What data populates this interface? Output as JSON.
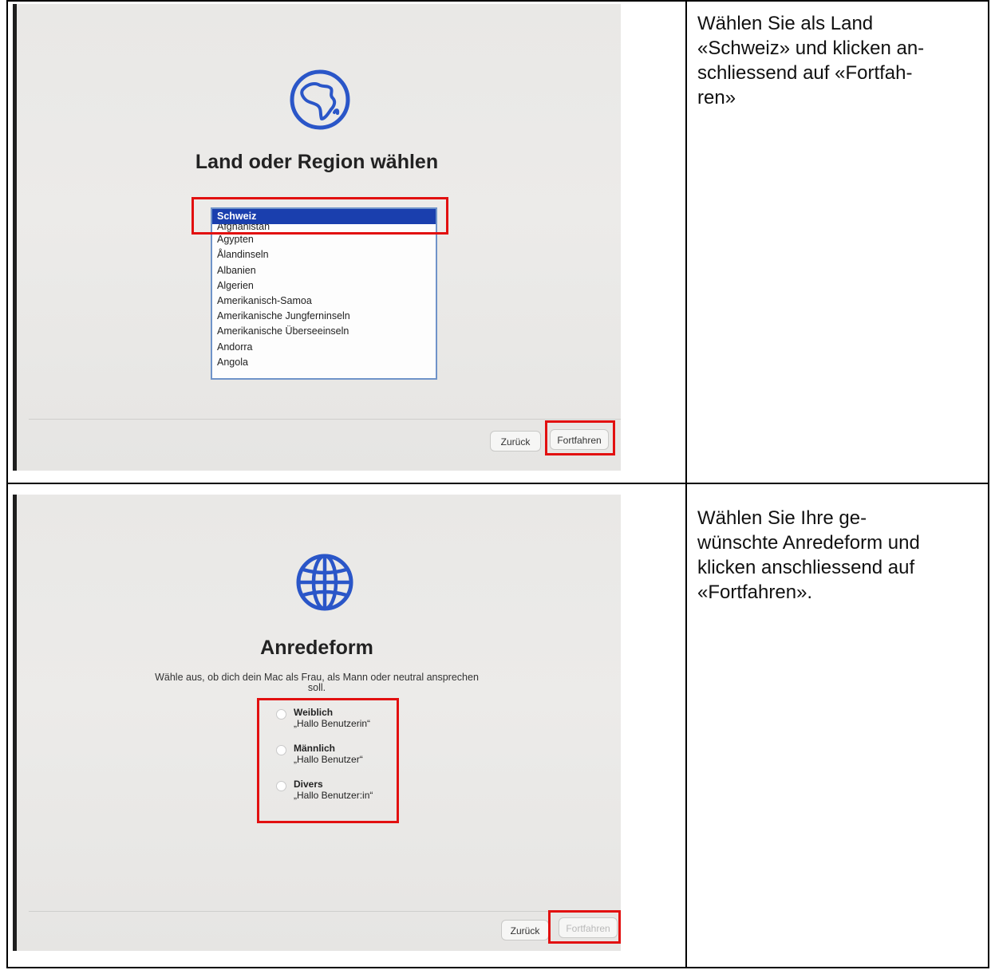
{
  "steps": [
    {
      "instruction": [
        "Wählen Sie als Land",
        "«Schweiz» und klicken an-",
        "schliessend auf «Fortfah-",
        "ren»"
      ],
      "screen": {
        "icon": "globe-africa-icon",
        "title": "Land oder Region wählen",
        "countries": [
          "Schweiz",
          "Afghanistan",
          "Ägypten",
          "Ålandinseln",
          "Albanien",
          "Algerien",
          "Amerikanisch-Samoa",
          "Amerikanische Jungferninseln",
          "Amerikanische Überseeinseln",
          "Andorra",
          "Angola"
        ],
        "selected_country": "Schweiz",
        "back_label": "Zurück",
        "continue_label": "Fortfahren"
      }
    },
    {
      "instruction": [
        "Wählen Sie Ihre ge-",
        "wünschte Anredeform und",
        "klicken anschliessend auf",
        "«Fortfahren»."
      ],
      "screen": {
        "icon": "globe-grid-icon",
        "title": "Anredeform",
        "subtitle_line1": "Wähle aus, ob dich dein Mac als Frau, als Mann oder neutral ansprechen",
        "subtitle_line2": "soll.",
        "options": [
          {
            "label": "Weiblich",
            "example": "„Hallo Benutzerin“"
          },
          {
            "label": "Männlich",
            "example": "„Hallo Benutzer“"
          },
          {
            "label": "Divers",
            "example": "„Hallo Benutzer:in“"
          }
        ],
        "back_label": "Zurück",
        "continue_label": "Fortfahren"
      }
    }
  ],
  "colors": {
    "highlight": "#e21010",
    "accent_blue": "#2a56c8",
    "selection": "#1a3fae"
  }
}
